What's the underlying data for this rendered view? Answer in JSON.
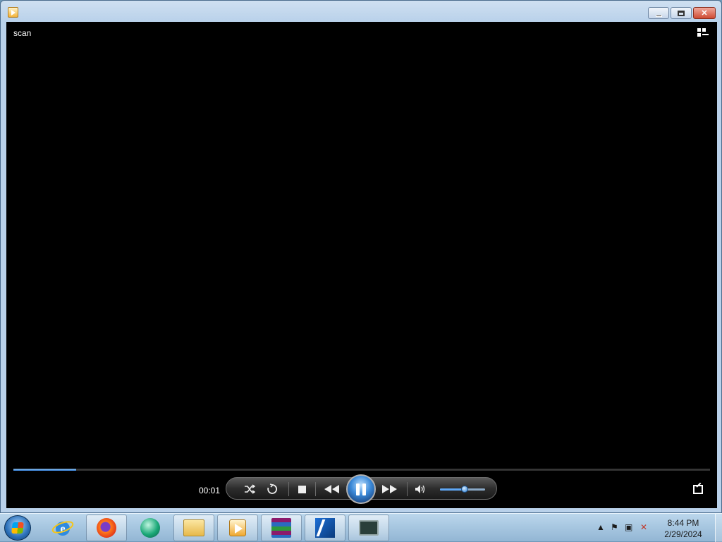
{
  "window": {
    "controls": {
      "minimize": "–",
      "maximize": "□",
      "close": "✕"
    }
  },
  "player": {
    "media_title": "scan",
    "elapsed_time": "00:01",
    "seek_progress": 0.09,
    "volume_level": 0.55,
    "icons": {
      "switch_to_library": "switch-to-library-icon",
      "shuffle": "shuffle-icon",
      "repeat": "repeat-icon",
      "stop": "stop-icon",
      "previous": "previous-icon",
      "pause": "pause-icon",
      "next": "next-icon",
      "mute": "speaker-icon",
      "fullscreen": "fullscreen-icon"
    }
  },
  "taskbar": {
    "apps": [
      {
        "name": "internet-explorer",
        "active": false
      },
      {
        "name": "firefox",
        "active": true
      },
      {
        "name": "app-green-sphere",
        "active": false
      },
      {
        "name": "file-explorer",
        "active": true
      },
      {
        "name": "windows-media-player",
        "active": true
      },
      {
        "name": "winrar",
        "active": true
      },
      {
        "name": "app-blue-k",
        "active": true
      },
      {
        "name": "app-monitor",
        "active": true
      }
    ],
    "clock": {
      "time": "8:44 PM",
      "date": "2/29/2024"
    }
  },
  "colors": {
    "seek_fill": "#4a90e2",
    "video_bg": "#000000",
    "close_button": "#cf4a32"
  }
}
